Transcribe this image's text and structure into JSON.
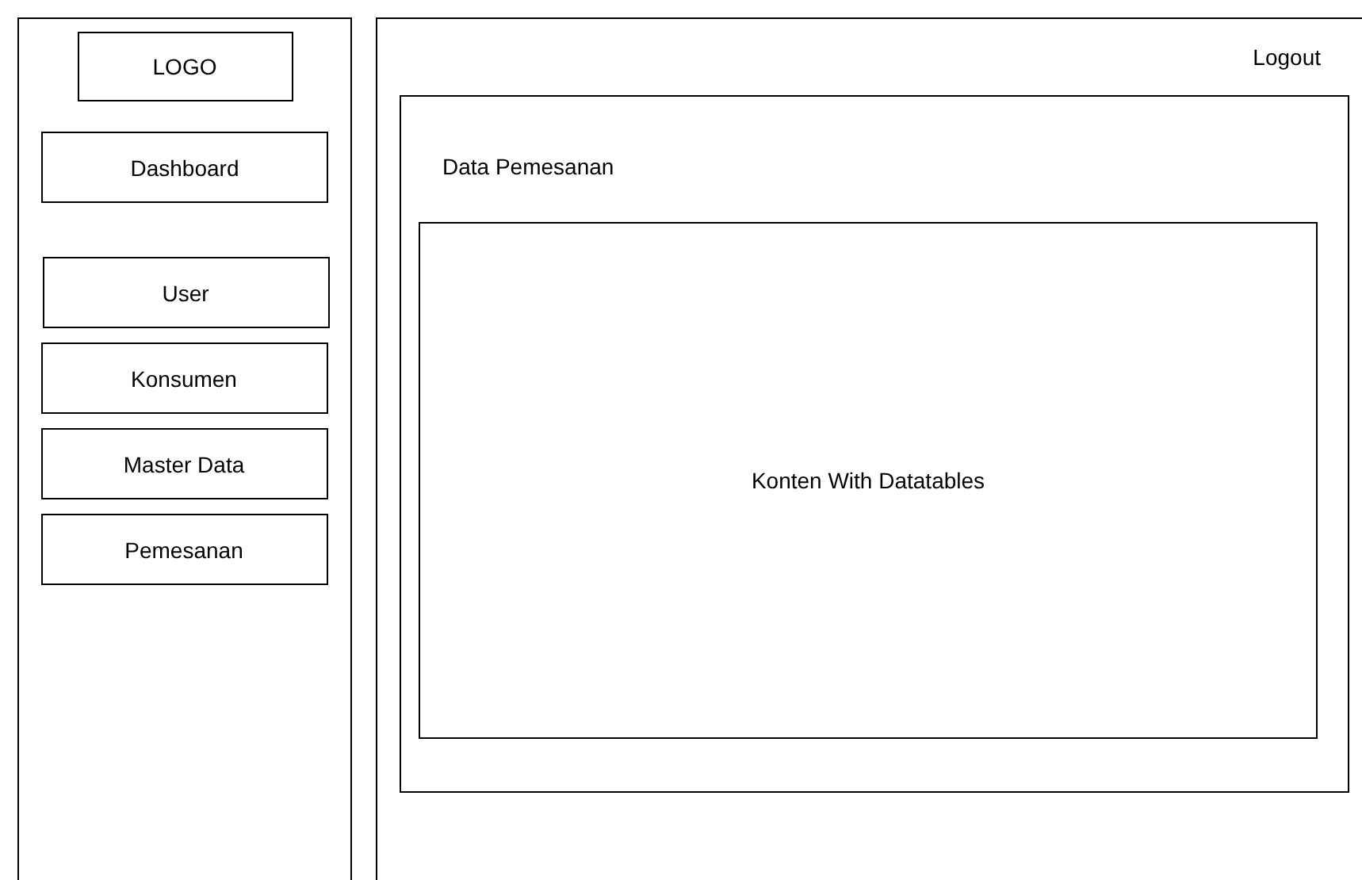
{
  "sidebar": {
    "logo": "LOGO",
    "items": [
      {
        "label": "Dashboard",
        "kind": "primary"
      },
      {
        "label": "User",
        "kind": "group"
      },
      {
        "label": "Konsumen",
        "kind": "group"
      },
      {
        "label": "Master Data",
        "kind": "group"
      },
      {
        "label": "Pemesanan",
        "kind": "group"
      }
    ]
  },
  "header": {
    "logout": "Logout"
  },
  "content": {
    "title": "Data Pemesanan",
    "table_placeholder": "Konten With Datatables"
  }
}
